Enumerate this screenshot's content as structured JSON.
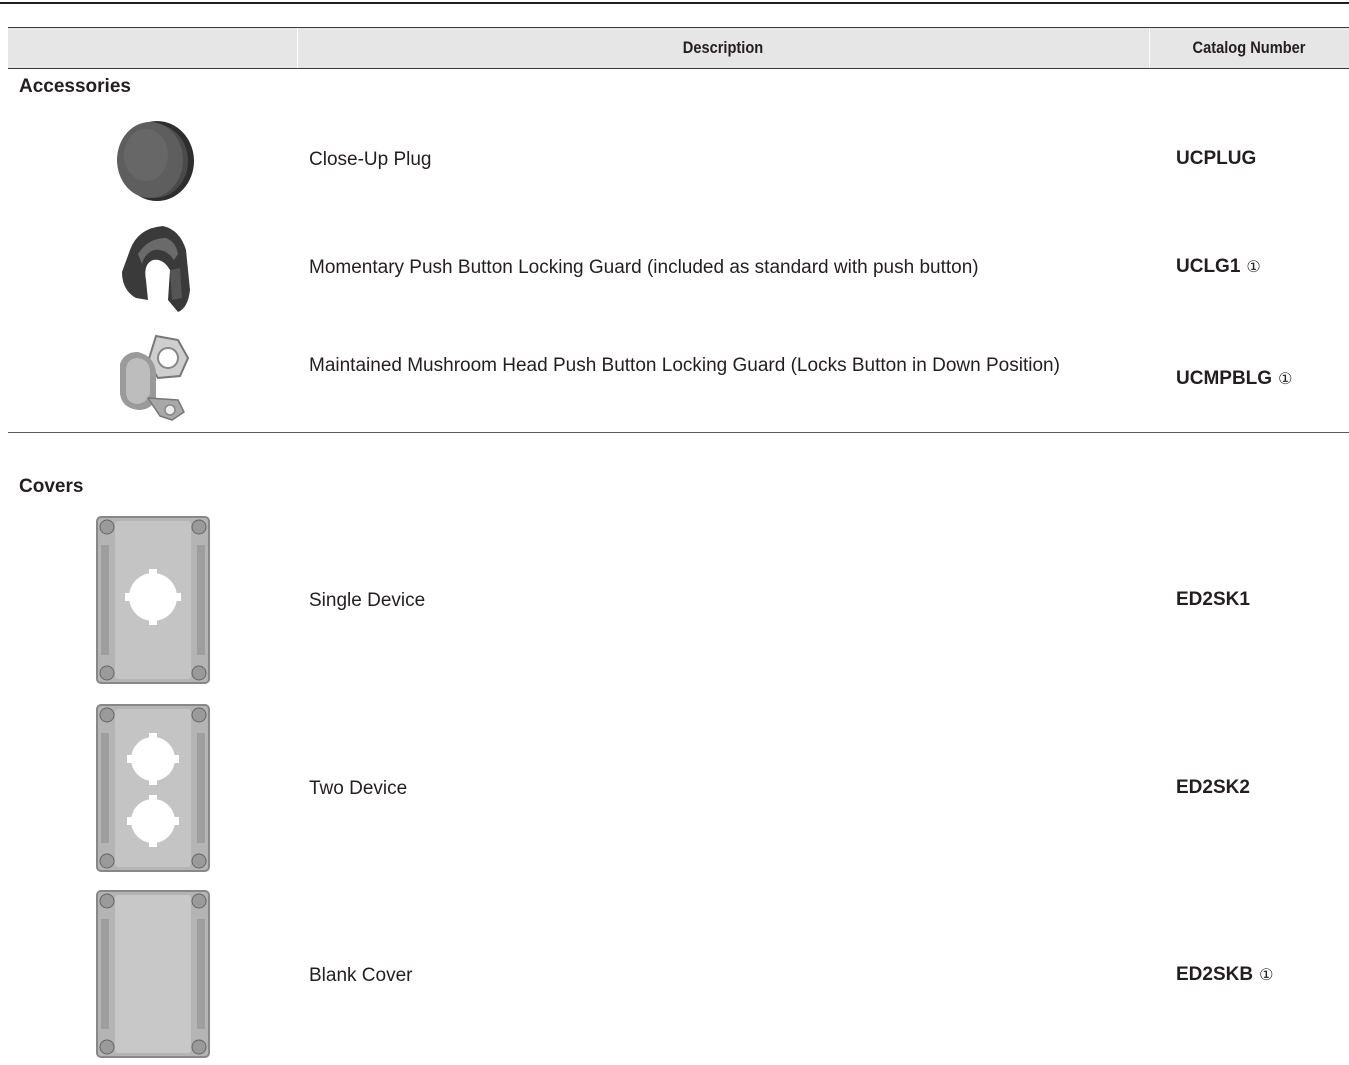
{
  "table": {
    "header": {
      "description": "Description",
      "catalog_number": "Catalog Number"
    }
  },
  "accessories": {
    "title": "Accessories",
    "items": [
      {
        "description": "Close-Up Plug",
        "catalog": "UCPLUG",
        "footnote": "",
        "icon": "round-plug-icon"
      },
      {
        "description": "Momentary Push Button Locking Guard (included as standard with push button)",
        "catalog": "UCLG1",
        "footnote": "①",
        "icon": "locking-guard-icon"
      },
      {
        "description": "Maintained Mushroom Head Push Button Locking Guard (Locks Button in Down Position)",
        "catalog": "UCMPBLG",
        "footnote": "①",
        "icon": "mushroom-guard-icon"
      }
    ]
  },
  "covers": {
    "title": "Covers",
    "items": [
      {
        "description": "Single Device",
        "catalog": "ED2SK1",
        "footnote": "",
        "icon": "single-device-cover-icon"
      },
      {
        "description": "Two Device",
        "catalog": "ED2SK2",
        "footnote": "",
        "icon": "two-device-cover-icon"
      },
      {
        "description": "Blank Cover",
        "catalog": "ED2SKB",
        "footnote": "①",
        "icon": "blank-cover-icon"
      }
    ]
  }
}
